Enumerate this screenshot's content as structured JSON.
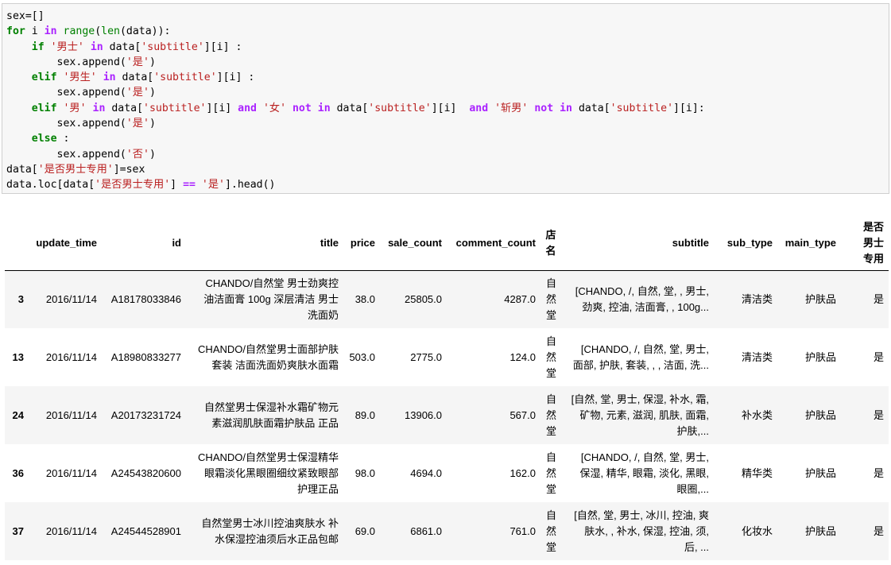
{
  "code_cell": {
    "lines": [
      [
        {
          "t": "pl",
          "v": "sex=[]"
        }
      ],
      [
        {
          "t": "kw",
          "v": "for"
        },
        {
          "t": "pl",
          "v": " i "
        },
        {
          "t": "op",
          "v": "in"
        },
        {
          "t": "pl",
          "v": " "
        },
        {
          "t": "bi",
          "v": "range"
        },
        {
          "t": "pl",
          "v": "("
        },
        {
          "t": "bi",
          "v": "len"
        },
        {
          "t": "pl",
          "v": "(data)):"
        }
      ],
      [
        {
          "t": "pl",
          "v": "    "
        },
        {
          "t": "kw",
          "v": "if"
        },
        {
          "t": "pl",
          "v": " "
        },
        {
          "t": "str",
          "v": "'男士'"
        },
        {
          "t": "pl",
          "v": " "
        },
        {
          "t": "op",
          "v": "in"
        },
        {
          "t": "pl",
          "v": " data["
        },
        {
          "t": "str",
          "v": "'subtitle'"
        },
        {
          "t": "pl",
          "v": "][i] :"
        }
      ],
      [
        {
          "t": "pl",
          "v": "        sex.append("
        },
        {
          "t": "str",
          "v": "'是'"
        },
        {
          "t": "pl",
          "v": ")"
        }
      ],
      [
        {
          "t": "pl",
          "v": "    "
        },
        {
          "t": "kw",
          "v": "elif"
        },
        {
          "t": "pl",
          "v": " "
        },
        {
          "t": "str",
          "v": "'男生'"
        },
        {
          "t": "pl",
          "v": " "
        },
        {
          "t": "op",
          "v": "in"
        },
        {
          "t": "pl",
          "v": " data["
        },
        {
          "t": "str",
          "v": "'subtitle'"
        },
        {
          "t": "pl",
          "v": "][i] :"
        }
      ],
      [
        {
          "t": "pl",
          "v": "        sex.append("
        },
        {
          "t": "str",
          "v": "'是'"
        },
        {
          "t": "pl",
          "v": ")"
        }
      ],
      [
        {
          "t": "pl",
          "v": "    "
        },
        {
          "t": "kw",
          "v": "elif"
        },
        {
          "t": "pl",
          "v": " "
        },
        {
          "t": "str",
          "v": "'男'"
        },
        {
          "t": "pl",
          "v": " "
        },
        {
          "t": "op",
          "v": "in"
        },
        {
          "t": "pl",
          "v": " data["
        },
        {
          "t": "str",
          "v": "'subtitle'"
        },
        {
          "t": "pl",
          "v": "][i] "
        },
        {
          "t": "op",
          "v": "and"
        },
        {
          "t": "pl",
          "v": " "
        },
        {
          "t": "str",
          "v": "'女'"
        },
        {
          "t": "pl",
          "v": " "
        },
        {
          "t": "op",
          "v": "not"
        },
        {
          "t": "pl",
          "v": " "
        },
        {
          "t": "op",
          "v": "in"
        },
        {
          "t": "pl",
          "v": " data["
        },
        {
          "t": "str",
          "v": "'subtitle'"
        },
        {
          "t": "pl",
          "v": "][i]  "
        },
        {
          "t": "op",
          "v": "and"
        },
        {
          "t": "pl",
          "v": " "
        },
        {
          "t": "str",
          "v": "'斩男'"
        },
        {
          "t": "pl",
          "v": " "
        },
        {
          "t": "op",
          "v": "not"
        },
        {
          "t": "pl",
          "v": " "
        },
        {
          "t": "op",
          "v": "in"
        },
        {
          "t": "pl",
          "v": " data["
        },
        {
          "t": "str",
          "v": "'subtitle'"
        },
        {
          "t": "pl",
          "v": "][i]:"
        }
      ],
      [
        {
          "t": "pl",
          "v": "        sex.append("
        },
        {
          "t": "str",
          "v": "'是'"
        },
        {
          "t": "pl",
          "v": ")"
        }
      ],
      [
        {
          "t": "pl",
          "v": "    "
        },
        {
          "t": "kw",
          "v": "else"
        },
        {
          "t": "pl",
          "v": " :"
        }
      ],
      [
        {
          "t": "pl",
          "v": "        sex.append("
        },
        {
          "t": "str",
          "v": "'否'"
        },
        {
          "t": "pl",
          "v": ")"
        }
      ],
      [
        {
          "t": "pl",
          "v": "data["
        },
        {
          "t": "str",
          "v": "'是否男士专用'"
        },
        {
          "t": "pl",
          "v": "]=sex"
        }
      ],
      [
        {
          "t": "pl",
          "v": "data.loc[data["
        },
        {
          "t": "str",
          "v": "'是否男士专用'"
        },
        {
          "t": "pl",
          "v": "] "
        },
        {
          "t": "op",
          "v": "=="
        },
        {
          "t": "pl",
          "v": " "
        },
        {
          "t": "str",
          "v": "'是'"
        },
        {
          "t": "pl",
          "v": "].head()"
        }
      ]
    ]
  },
  "table": {
    "headers": {
      "update_time": "update_time",
      "id": "id",
      "title": "title",
      "price": "price",
      "sale_count": "sale_count",
      "comment_count": "comment_count",
      "shop": [
        "店",
        "名"
      ],
      "subtitle": "subtitle",
      "sub_type": "sub_type",
      "main_type": "main_type",
      "is_male": [
        "是否",
        "男士",
        "专用"
      ]
    },
    "rows": [
      {
        "index": "3",
        "update_time": "2016/11/14",
        "id": "A18178033846",
        "title": [
          "CHANDO/自然堂 男士劲爽控",
          "油洁面膏 100g 深层清洁 男士",
          "洗面奶"
        ],
        "price": "38.0",
        "sale_count": "25805.0",
        "comment_count": "4287.0",
        "shop": [
          "自",
          "然",
          "堂"
        ],
        "subtitle": [
          "[CHANDO, /, 自然, 堂, , 男士,",
          "劲爽, 控油, 洁面膏, , 100g..."
        ],
        "sub_type": "清洁类",
        "main_type": "护肤品",
        "is_male": "是"
      },
      {
        "index": "13",
        "update_time": "2016/11/14",
        "id": "A18980833277",
        "title": [
          "CHANDO/自然堂男士面部护肤",
          "套装 洁面洗面奶爽肤水面霜"
        ],
        "price": "503.0",
        "sale_count": "2775.0",
        "comment_count": "124.0",
        "shop": [
          "自",
          "然",
          "堂"
        ],
        "subtitle": [
          "[CHANDO, /, 自然, 堂, 男士,",
          "面部, 护肤, 套装, , , 洁面, 洗..."
        ],
        "sub_type": "清洁类",
        "main_type": "护肤品",
        "is_male": "是"
      },
      {
        "index": "24",
        "update_time": "2016/11/14",
        "id": "A20173231724",
        "title": [
          "自然堂男士保湿补水霜矿物元",
          "素滋润肌肤面霜护肤品 正品"
        ],
        "price": "89.0",
        "sale_count": "13906.0",
        "comment_count": "567.0",
        "shop": [
          "自",
          "然",
          "堂"
        ],
        "subtitle": [
          "[自然, 堂, 男士, 保湿, 补水, 霜,",
          "矿物, 元素, 滋润, 肌肤, 面霜,",
          "护肤,..."
        ],
        "sub_type": "补水类",
        "main_type": "护肤品",
        "is_male": "是"
      },
      {
        "index": "36",
        "update_time": "2016/11/14",
        "id": "A24543820600",
        "title": [
          "CHANDO/自然堂男士保湿精华",
          "眼霜淡化黑眼圈细纹紧致眼部",
          "护理正品"
        ],
        "price": "98.0",
        "sale_count": "4694.0",
        "comment_count": "162.0",
        "shop": [
          "自",
          "然",
          "堂"
        ],
        "subtitle": [
          "[CHANDO, /, 自然, 堂, 男士,",
          "保湿, 精华, 眼霜, 淡化, 黑眼,",
          "眼圈,..."
        ],
        "sub_type": "精华类",
        "main_type": "护肤品",
        "is_male": "是"
      },
      {
        "index": "37",
        "update_time": "2016/11/14",
        "id": "A24544528901",
        "title": [
          "自然堂男士冰川控油爽肤水 补",
          "水保湿控油须后水正品包邮"
        ],
        "price": "69.0",
        "sale_count": "6861.0",
        "comment_count": "761.0",
        "shop": [
          "自",
          "然",
          "堂"
        ],
        "subtitle": [
          "[自然, 堂, 男士, 冰川, 控油, 爽",
          "肤水, , 补水, 保湿, 控油, 须,",
          "后, ..."
        ],
        "sub_type": "化妆水",
        "main_type": "护肤品",
        "is_male": "是"
      }
    ]
  }
}
